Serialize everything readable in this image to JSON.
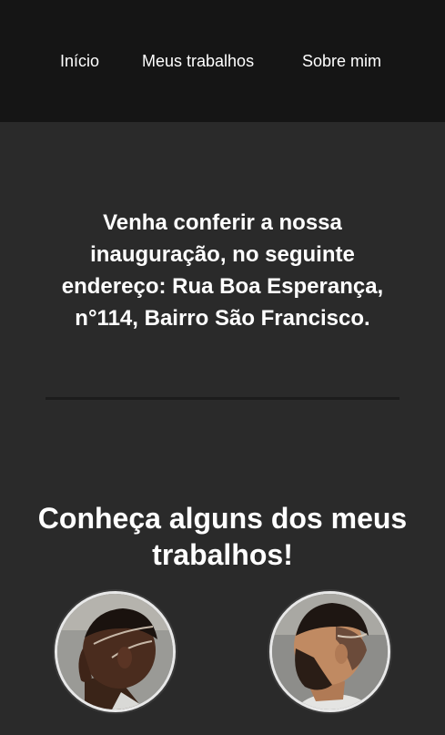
{
  "nav": {
    "items": [
      {
        "label": "Início"
      },
      {
        "label": "Meus trabalhos"
      },
      {
        "label": "Sobre mim"
      }
    ]
  },
  "announcement": {
    "text": "Venha conferir a nossa inauguração, no seguinte endereço: Rua Boa Esperança, n°114, Bairro São Francisco."
  },
  "works": {
    "title": "Conheça alguns dos meus trabalhos!"
  },
  "colors": {
    "header_bg": "#151515",
    "page_bg": "#2a2a2a",
    "text": "#ffffff",
    "photo_border": "#e8e8e8"
  }
}
